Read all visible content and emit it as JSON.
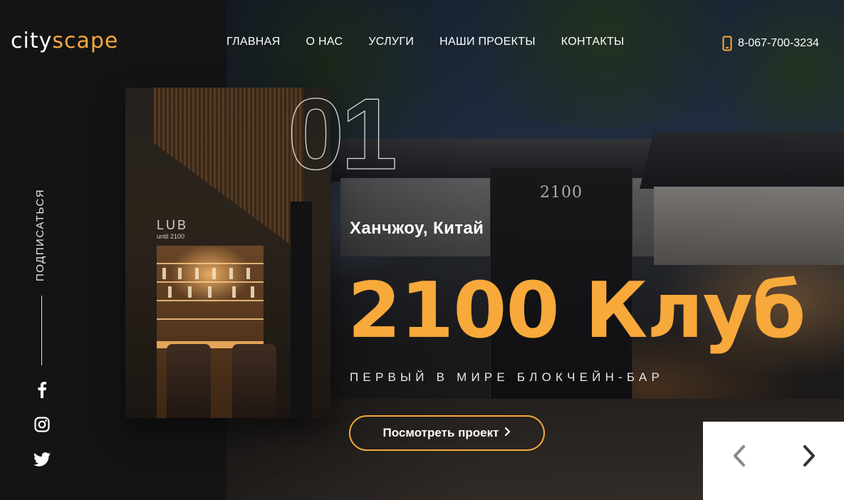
{
  "logo": {
    "part1": "city",
    "part2": "scape"
  },
  "nav": {
    "items": [
      {
        "label": "ГЛАВНАЯ"
      },
      {
        "label": "О НАС"
      },
      {
        "label": "УСЛУГИ"
      },
      {
        "label": "НАШИ ПРОЕКТЫ"
      },
      {
        "label": "КОНТАКТЫ"
      }
    ]
  },
  "header": {
    "phone": "8-067-700-3234",
    "phone_icon": "mobile-phone-icon"
  },
  "sidebar": {
    "subscribe_label": "ПОДПИСАТЬСЯ",
    "social": [
      "facebook-icon",
      "instagram-icon",
      "twitter-icon"
    ]
  },
  "slide": {
    "number": "01",
    "location": "Ханчжоу, Китай",
    "title": "2100 Клуб",
    "subtitle": "ПЕРВЫЙ В МИРЕ БЛОКЧЕЙН-БАР",
    "cta_label": "Посмотреть проект",
    "cta_icon": "chevron-right-icon"
  },
  "slider_controls": {
    "prev_icon": "chevron-left-icon",
    "next_icon": "chevron-right-icon"
  },
  "colors": {
    "accent": "#f7a93b",
    "dark": "#141414",
    "prev_arrow": "#888888",
    "next_arrow": "#333333"
  }
}
